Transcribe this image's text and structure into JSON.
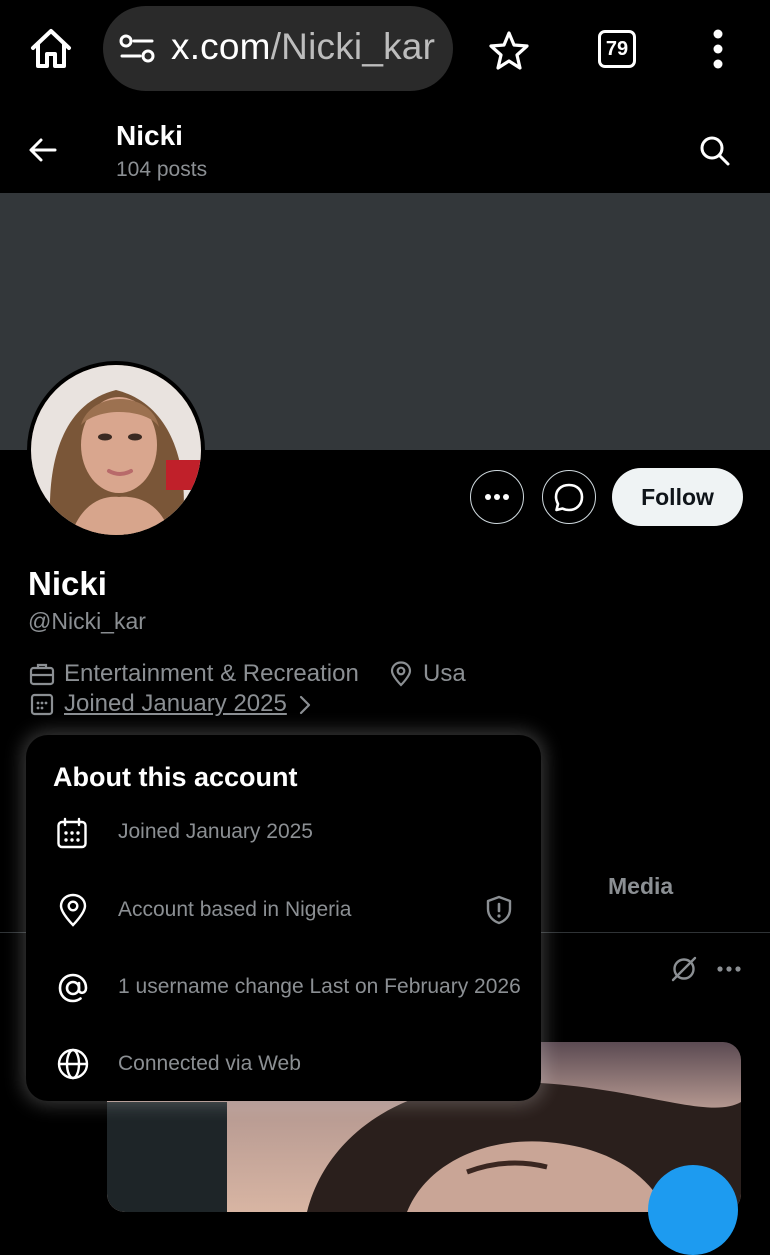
{
  "browser": {
    "url_host": "x.com",
    "url_path": "/Nicki_kar",
    "tab_count": "79",
    "icons": [
      "home-icon",
      "site-settings-icon",
      "star-icon",
      "tabs-icon",
      "more-vert-icon"
    ]
  },
  "header": {
    "name": "Nicki",
    "posts": "104 posts"
  },
  "profile": {
    "display_name": "Nicki",
    "handle": "@Nicki_kar",
    "category": "Entertainment & Recreation",
    "location": "Usa",
    "joined": "Joined January 2025",
    "follow_label": "Follow"
  },
  "tabs": {
    "media": "Media"
  },
  "about_popup": {
    "title": "About this account",
    "joined": "Joined January 2025",
    "based_in": "Account based in Nigeria",
    "username_changes": "1 username change Last on February 2026",
    "connected_via": "Connected via Web"
  },
  "colors": {
    "background": "#000000",
    "banner": "#33373a",
    "follow_button": "#eff3f4",
    "accent_blue": "#1d9bf0",
    "muted_text": "#8b8f93"
  }
}
